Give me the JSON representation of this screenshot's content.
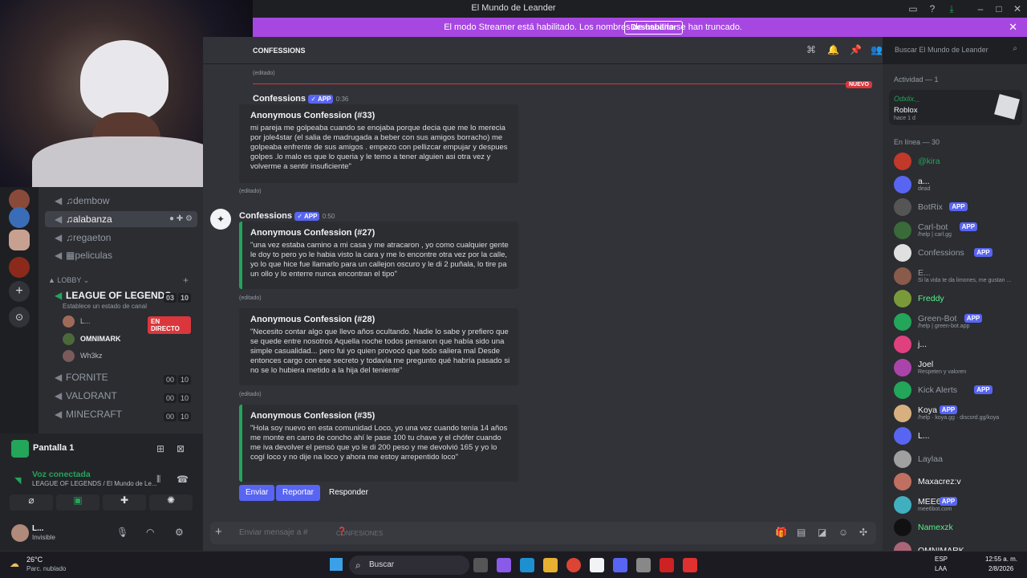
{
  "window": {
    "title": "El Mundo de Leander"
  },
  "banner": {
    "message": "El modo Streamer está habilitado. Los nombres de usuario se han truncado.",
    "button": "Deshabilitar"
  },
  "header": {
    "channel": "CONFESSIONS",
    "search_placeholder": "Buscar El Mundo de Leander"
  },
  "channels": {
    "items": [
      {
        "label": "dembow"
      },
      {
        "label": "alabanza"
      },
      {
        "label": "regaeton"
      },
      {
        "label": "peliculas"
      }
    ],
    "lobby_label": "LOBBY",
    "voice": [
      {
        "label": "LEAGUE OF LEGENDS",
        "a": "03",
        "b": "10",
        "status": "Establece un estado de canal"
      },
      {
        "label": "FORNITE",
        "a": "00",
        "b": "10"
      },
      {
        "label": "VALORANT",
        "a": "00",
        "b": "10"
      },
      {
        "label": "MINECRAFT",
        "a": "00",
        "b": "10"
      }
    ],
    "voice_users": [
      {
        "name": "L...",
        "badge": "EN DIRECTO"
      },
      {
        "name": "OMNIMARK"
      },
      {
        "name": "Wh3kz"
      }
    ]
  },
  "voice_panel": {
    "screen": "Pantalla 1",
    "connected": "Voz conectada",
    "location": "LEAGUE OF LEGENDS / El Mundo de Le...",
    "user": "L...",
    "user_status": "Invisible"
  },
  "messages": {
    "top_label": "(editado)",
    "new_label": "NUEVO",
    "author1": "Confessions",
    "app": "APP",
    "time1": "0:36",
    "c33_title": "Anonymous Confession (#33)",
    "c33_body": "mi pareja me golpeaba cuando se enojaba porque decia que me lo merecia por jole4star (el salia de madrugada a beber con sus amigos borracho) me golpeaba enfrente de sus amigos . empezo con pellizcar empujar y despues golpes .lo malo es que lo queria y le temo a tener alguien asi otra vez y volverme a sentir insuficiente\"",
    "edited": "(editado)",
    "author2": "Confessions",
    "time2": "0:50",
    "c27_title": "Anonymous Confession (#27)",
    "c27_body": "\"una vez estaba camino a mi casa y me atracaron , yo como cualquier gente le doy to pero yo le habia visto la cara y me lo encontre otra vez por la calle, yo lo que hice fue llamarlo para un callejon oscuro y le di 2 puñala, lo tire pa un ollo y lo enterre nunca encontran el tipo\"",
    "c28_title": "Anonymous Confession (#28)",
    "c28_body": "\"Necesito contar algo que llevo años ocultando. Nadie lo sabe y prefiero que se quede entre nosotros Aquella noche todos pensaron que había sido una simple casualidad... pero fui yo quien provocó que todo saliera mal Desde entonces cargo con ese secreto y todavía me pregunto qué habría pasado si no se lo hubiera metido a la hija del teniente\"",
    "c35_title": "Anonymous Confession (#35)",
    "c35_body": "\"Hola soy nuevo en esta comunidad Loco, yo una vez cuando tenía 14 años me monte en carro de concho ahí le pase 100 tu chave y el chófer cuando me iva devolver el pensó que yo le di 200 peso y me devolvió 165 y yo lo cogí loco y no dije na loco y ahora me estoy arrepentido loco\"",
    "buttons": {
      "send": "Enviar",
      "report": "Reportar",
      "reply": "Responder"
    }
  },
  "composer": {
    "placeholder": "Enviar mensaje a #",
    "channel": "CONFESIONES"
  },
  "members": {
    "activity_header": "Actividad — 1",
    "activity_user": "Odxlix._",
    "activity_game": "Roblox",
    "activity_time": "hace 1 d",
    "online_header": "En línea — 30",
    "list": [
      {
        "name": "@kira",
        "sub": "",
        "color": "#23a55a"
      },
      {
        "name": "a...",
        "sub": "dead",
        "color": "#f2f3f5"
      },
      {
        "name": "BotRix",
        "sub": "",
        "color": "#949ba4",
        "app": "APP"
      },
      {
        "name": "Carl-bot",
        "sub": "/help | carl.gg",
        "color": "#949ba4",
        "app": "APP"
      },
      {
        "name": "Confessions",
        "sub": "",
        "color": "#949ba4",
        "app": "APP"
      },
      {
        "name": "E...",
        "sub": "Si la vida te da limones, me gustan ...",
        "color": "#949ba4"
      },
      {
        "name": "Freddy",
        "sub": "",
        "color": "#57f287"
      },
      {
        "name": "Green-Bot",
        "sub": "/help | green-bot.app",
        "color": "#949ba4",
        "app": "APP"
      },
      {
        "name": "j...",
        "sub": "",
        "color": "#f2f3f5"
      },
      {
        "name": "Joel",
        "sub": "Respeten y valoren",
        "color": "#f2f3f5"
      },
      {
        "name": "Kick Alerts",
        "sub": "",
        "color": "#949ba4",
        "app": "APP"
      },
      {
        "name": "Koya",
        "sub": "/help · koya.gg · discord.gg/koya",
        "color": "#f2f3f5",
        "app": "APP"
      },
      {
        "name": "L...",
        "sub": "",
        "color": "#f2f3f5"
      },
      {
        "name": "Laylaa",
        "sub": "",
        "color": "#949ba4"
      },
      {
        "name": "Maxacrez:v",
        "sub": "",
        "color": "#f2f3f5"
      },
      {
        "name": "MEE6",
        "sub": "mee6bot.com",
        "color": "#f2f3f5",
        "app": "APP"
      },
      {
        "name": "Namexzk",
        "sub": "",
        "color": "#57f287"
      },
      {
        "name": "OMNIMARK",
        "sub": "",
        "color": "#f2f3f5"
      }
    ]
  },
  "taskbar": {
    "weather_temp": "26°C",
    "weather_desc": "Parc. nublado",
    "search": "Buscar",
    "lang": "ESP",
    "region": "LAA",
    "time": "12:55 a. m.",
    "date": "2/8/2026"
  }
}
